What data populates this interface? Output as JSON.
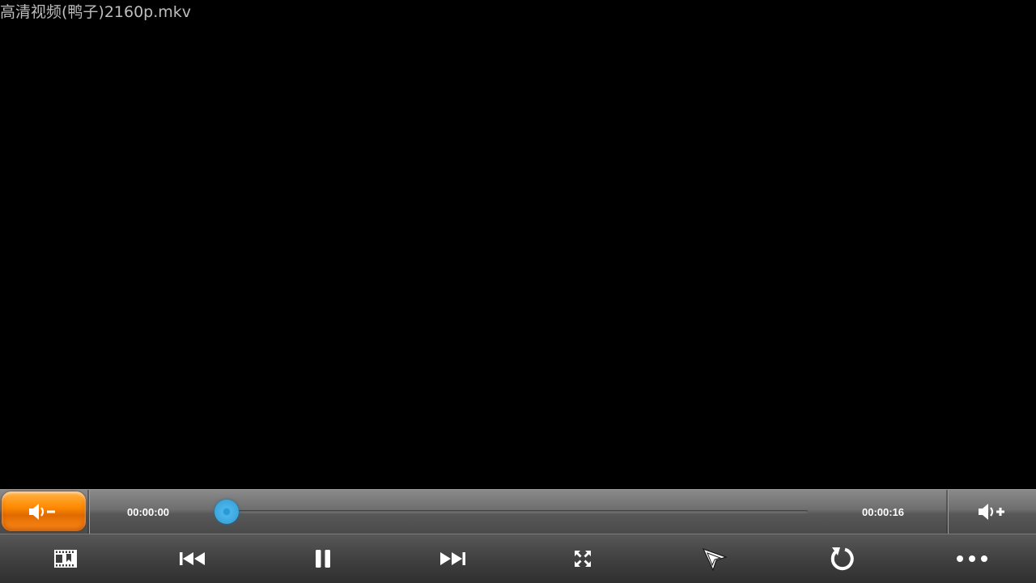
{
  "player": {
    "title": "高清视频(鸭子)2160p.mkv",
    "current_time": "00:00:00",
    "total_time": "00:00:16",
    "progress": 0.0
  },
  "progress_bar": {
    "volume_down_icon": "volume-down-icon",
    "volume_up_icon": "volume-up-icon",
    "seek_color": "#3aa6de",
    "volume_down_color": "#ff8a00"
  },
  "controls": [
    {
      "name": "playlist-button",
      "icon": "film-bookmark-icon"
    },
    {
      "name": "previous-button",
      "icon": "skip-previous-icon"
    },
    {
      "name": "pause-button",
      "icon": "pause-icon"
    },
    {
      "name": "next-button",
      "icon": "skip-next-icon"
    },
    {
      "name": "fullscreen-button",
      "icon": "fullscreen-icon"
    },
    {
      "name": "pointer-button",
      "icon": "cursor-pointer-icon"
    },
    {
      "name": "repeat-button",
      "icon": "refresh-icon"
    },
    {
      "name": "more-button",
      "icon": "more-dots-icon"
    }
  ]
}
